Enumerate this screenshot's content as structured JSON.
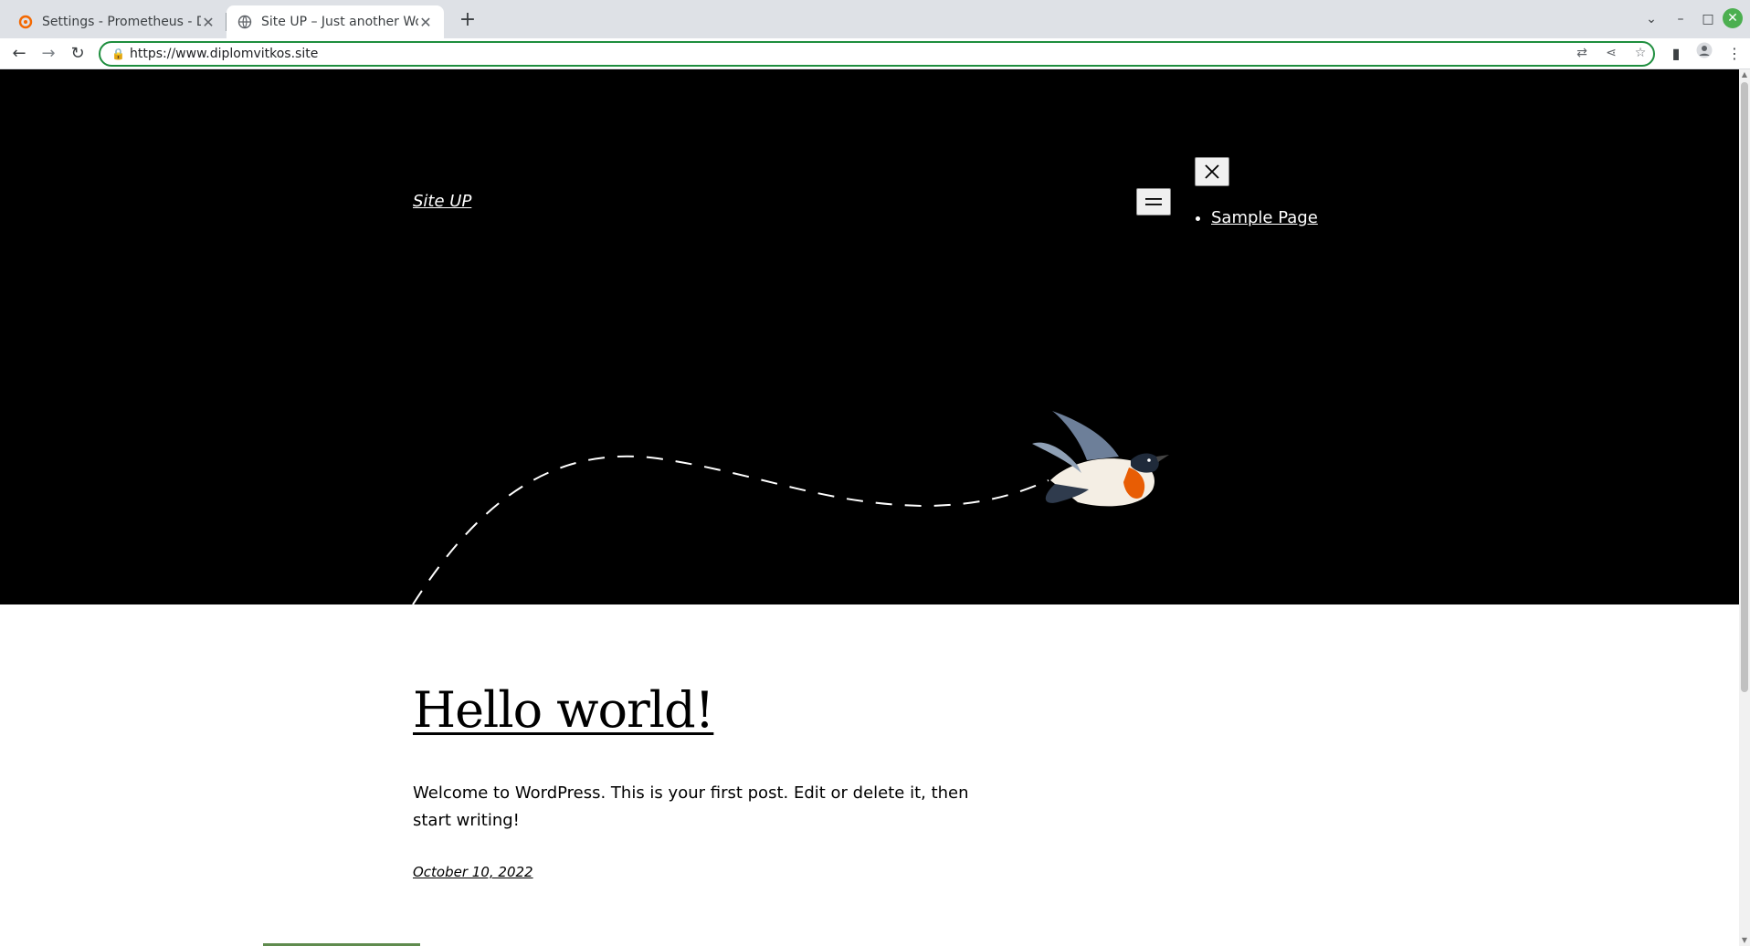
{
  "browser": {
    "tabs": [
      {
        "title": "Settings - Prometheus - Data s",
        "active": false,
        "icon": "grafana-icon"
      },
      {
        "title": "Site UP – Just another WordPr",
        "active": true,
        "icon": "globe-icon"
      }
    ],
    "url": "https://www.diplomvitkos.site",
    "accent_color": "#1e8e3e"
  },
  "site": {
    "title": "Site UP",
    "nav_items": [
      "Sample Page"
    ]
  },
  "post": {
    "title": "Hello world!",
    "excerpt": "Welcome to WordPress. This is your first post. Edit or delete it, then start writing!",
    "date": "October 10, 2022"
  }
}
